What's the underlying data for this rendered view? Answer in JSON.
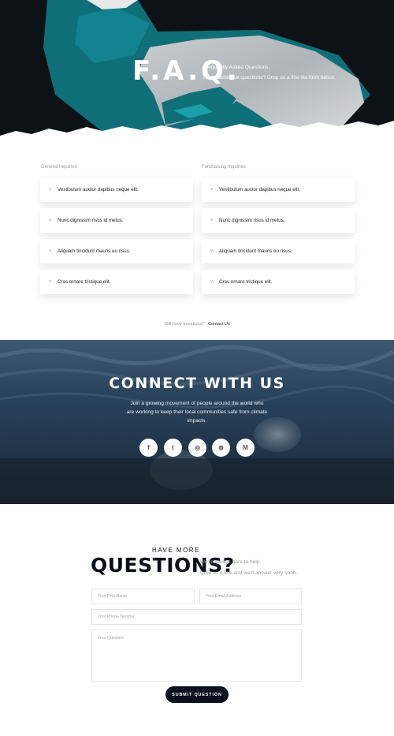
{
  "hero": {
    "title": "F.A.Q.",
    "subtitle_line1": "Frequently Asked Questions.",
    "subtitle_line2": "Have additional questions? Drop us a line via form below."
  },
  "faq": {
    "general": {
      "title": "General Inquiries",
      "items": [
        "Vestibulum auctor dapibus neque elit.",
        "Nunc dignissim risus id metus.",
        "Aliquam tincidunt mauris eu risus.",
        "Cras ornare tristique elit."
      ]
    },
    "fundraising": {
      "title": "Fundraising Inquiries",
      "items": [
        "Vestibulum auctor dapibus neque elit.",
        "Nunc dignissim risus id metus.",
        "Aliquam tincidunt mauris eu risus.",
        "Cras ornare tristique elit."
      ]
    },
    "chevron": "˅",
    "still_text": "Still have questions?",
    "contact_link": "Contact Us"
  },
  "connect": {
    "title": "CONNECT WITH US",
    "text": "Join a growing movement of people around the world who are working to keep their local communities safe from climate impacts.",
    "socials": [
      {
        "icon": "facebook-icon",
        "glyph": "f"
      },
      {
        "icon": "twitter-icon",
        "glyph": "t"
      },
      {
        "icon": "instagram-icon",
        "glyph": "◎"
      },
      {
        "icon": "dribbble-icon",
        "glyph": "⊛"
      },
      {
        "icon": "medium-icon",
        "glyph": "M"
      }
    ]
  },
  "contact": {
    "have_more": "HAVE MORE",
    "questions": "QUESTIONS?",
    "help_line1": "We're always here to help.",
    "help_line2": "Drop us a line and we'll answer very soon.",
    "first_name_placeholder": "Your First Name",
    "email_placeholder": "Your Email Address",
    "phone_placeholder": "Your Phone Number",
    "question_placeholder": "Your Question",
    "submit_label": "SUBMIT QUESTION"
  },
  "colors": {
    "dark": "#0c0f1c",
    "ice_teal": "#0f6f78",
    "ocean": "#1f3142"
  }
}
